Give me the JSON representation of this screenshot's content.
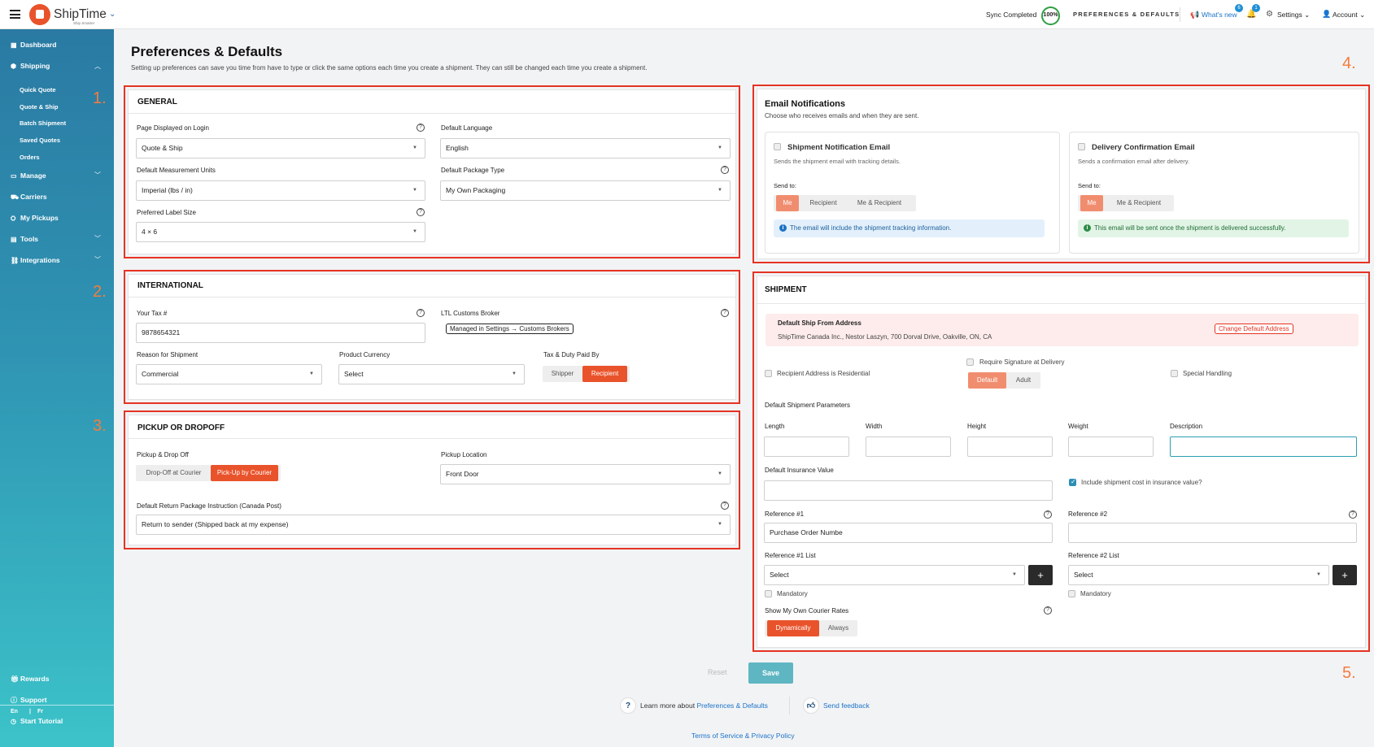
{
  "topbar": {
    "brand": "ShipTime",
    "brand_sub": "Ship Smarter",
    "sync_status": "Sync Completed",
    "sync_percent": "100%",
    "prefs_link": "PREFERENCES & DEFAULTS",
    "whats_new": "What's new",
    "whats_new_count": "6",
    "notifications_count": "1",
    "settings": "Settings",
    "account": "Account"
  },
  "sidebar": {
    "items": [
      {
        "label": "Dashboard",
        "icon": "grid-icon"
      },
      {
        "label": "Shipping",
        "icon": "box-icon"
      },
      {
        "label": "Manage",
        "icon": "monitor-icon"
      },
      {
        "label": "Carriers",
        "icon": "truck-icon"
      },
      {
        "label": "My Pickups",
        "icon": "pickup-icon"
      },
      {
        "label": "Tools",
        "icon": "toolbox-icon"
      },
      {
        "label": "Integrations",
        "icon": "link-icon"
      }
    ],
    "shipping_sub": [
      "Quick Quote",
      "Quote & Ship",
      "Batch Shipment",
      "Saved Quotes",
      "Orders"
    ],
    "bottom": [
      {
        "label": "Rewards",
        "icon": "gift-icon"
      },
      {
        "label": "Support",
        "icon": "help-icon"
      },
      {
        "label": "Start Tutorial",
        "icon": "tutorial-icon"
      }
    ],
    "lang_en": "En",
    "lang_fr": "Fr"
  },
  "page": {
    "title": "Preferences & Defaults",
    "description": "Setting up preferences can save you time from have to type or click the same options each time you create a shipment. They can still be changed each time you create a shipment."
  },
  "annotations": [
    "1.",
    "2.",
    "3.",
    "4.",
    "5."
  ],
  "general": {
    "title": "GENERAL",
    "page_login_label": "Page Displayed on Login",
    "page_login_value": "Quote & Ship",
    "language_label": "Default Language",
    "language_value": "English",
    "units_label": "Default Measurement Units",
    "units_value": "Imperial (lbs / in)",
    "package_label": "Default Package Type",
    "package_value": "My Own Packaging",
    "label_size_label": "Preferred Label Size",
    "label_size_value": "4 × 6"
  },
  "international": {
    "title": "INTERNATIONAL",
    "tax_label": "Your Tax #",
    "tax_value": "9878654321",
    "broker_label": "LTL Customs Broker",
    "broker_chip": "Managed in Settings → Customs Brokers",
    "reason_label": "Reason for Shipment",
    "reason_value": "Commercial",
    "currency_label": "Product Currency",
    "currency_value": "Select",
    "duty_label": "Tax & Duty Paid By",
    "duty_options": [
      "Shipper",
      "Recipient"
    ]
  },
  "pickup": {
    "title": "PICKUP OR DROPOFF",
    "mode_label": "Pickup & Drop Off",
    "mode_options": [
      "Drop-Off at Courier",
      "Pick-Up by Courier"
    ],
    "location_label": "Pickup Location",
    "location_value": "Front Door",
    "return_label": "Default Return Package Instruction (Canada Post)",
    "return_value": "Return to sender (Shipped back at my expense)"
  },
  "email": {
    "title": "Email Notifications",
    "subtitle": "Choose who receives emails and when they are sent.",
    "shipment": {
      "title": "Shipment Notification Email",
      "desc": "Sends the shipment email with tracking details.",
      "send_to": "Send to:",
      "options": [
        "Me",
        "Recipient",
        "Me & Recipient"
      ],
      "info": "The email will include the shipment tracking information."
    },
    "delivery": {
      "title": "Delivery Confirmation Email",
      "desc": "Sends a confirmation email after delivery.",
      "send_to": "Send to:",
      "options": [
        "Me",
        "Me & Recipient"
      ],
      "info": "This email will be sent once the shipment is delivered successfully."
    }
  },
  "shipment": {
    "title": "SHIPMENT",
    "from_title": "Default Ship From Address",
    "from_address": "ShipTime Canada Inc., Nestor Laszyn, 700 Dorval Drive, Oakville, ON, CA",
    "change_address": "Change Default Address",
    "residential": "Recipient Address is Residential",
    "signature": "Require Signature at Delivery",
    "signature_options": [
      "Default",
      "Adult"
    ],
    "special": "Special Handling",
    "params_title": "Default Shipment Parameters",
    "dims": [
      "Length",
      "Width",
      "Height",
      "Weight",
      "Description"
    ],
    "insurance_label": "Default Insurance Value",
    "include_cost": "Include shipment cost in insurance value?",
    "ref1_label": "Reference #1",
    "ref1_value": "Purchase Order Numbe",
    "ref2_label": "Reference #2",
    "ref2_value": "",
    "ref1_list_label": "Reference #1 List",
    "ref1_list_value": "Select",
    "ref2_list_label": "Reference #2 List",
    "ref2_list_value": "Select",
    "mandatory": "Mandatory",
    "rates_label": "Show My Own Courier Rates",
    "rates_options": [
      "Dynamically",
      "Always"
    ]
  },
  "footer": {
    "reset": "Reset",
    "save": "Save",
    "learn_prefix": "Learn more about ",
    "learn_link": "Preferences & Defaults",
    "feedback": "Send feedback",
    "terms": "Terms of Service & Privacy Policy"
  }
}
